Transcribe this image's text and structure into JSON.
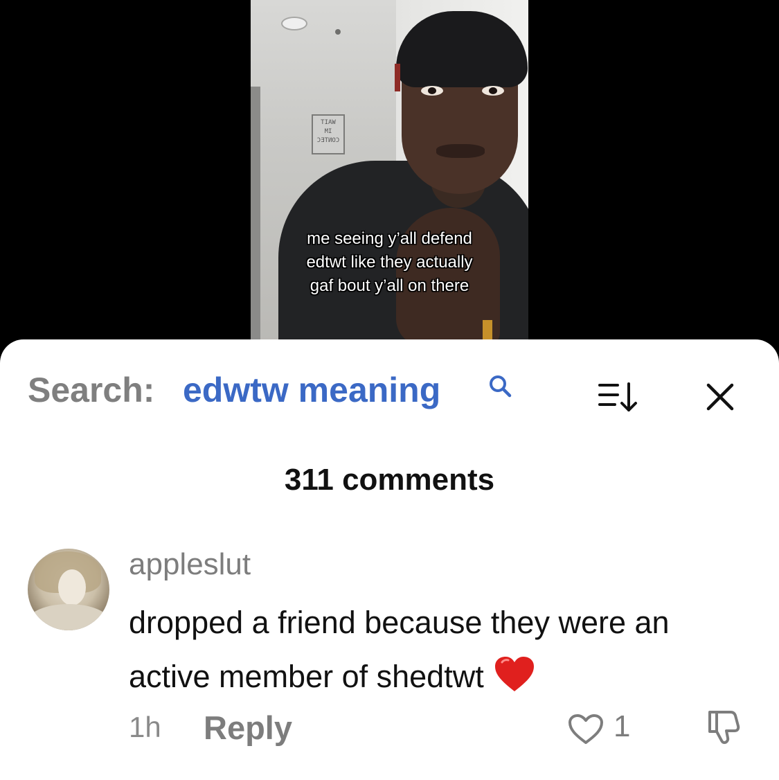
{
  "video": {
    "caption_lines": [
      "me seeing y’all defend",
      "edtwt like they actually",
      "gaf bout y’all on there"
    ],
    "poster_lines": [
      "TIAW",
      "MI",
      "ƆƎTИOƆ"
    ]
  },
  "search": {
    "label": "Search:",
    "query": "edwtw meaning",
    "icon": "search-icon"
  },
  "toolbar": {
    "sort_icon": "sort-icon",
    "close_icon": "close-icon"
  },
  "comments_count_label": "311 comments",
  "comment": {
    "username": "appleslut",
    "text": "dropped a friend because they were an active member of shedtwt",
    "emoji": "red-heart",
    "time": "1h",
    "reply_label": "Reply",
    "like_count": "1",
    "like_icon": "heart-outline-icon",
    "dislike_icon": "thumbs-down-icon"
  },
  "colors": {
    "query": "#3b69c5",
    "muted": "#7d7d7d",
    "text": "#111111",
    "heart": "#e0201e"
  }
}
